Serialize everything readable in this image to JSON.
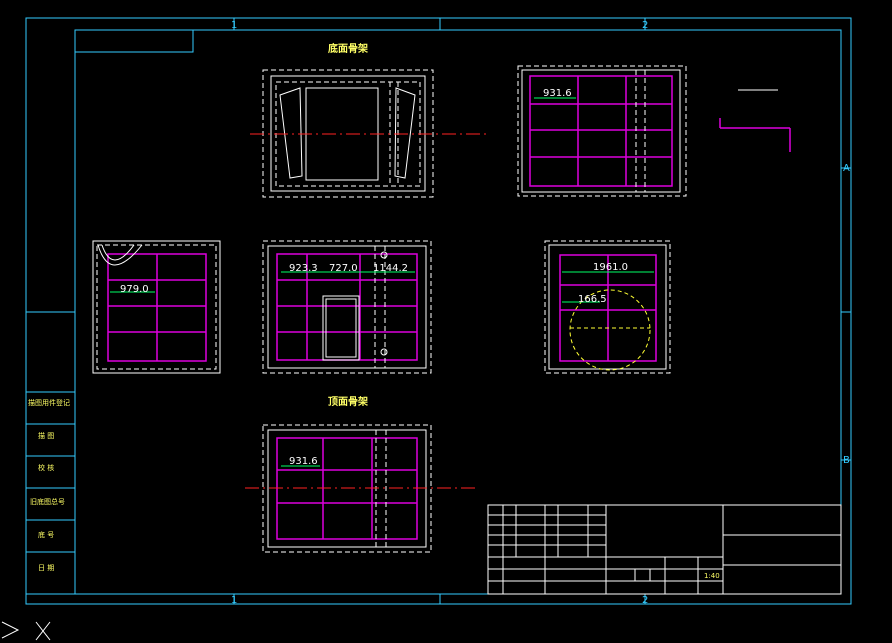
{
  "drawing": {
    "view_titles": {
      "bottom_frame": "底面骨架",
      "top_frame": "顶面骨架"
    },
    "dimensions": {
      "top_right_view": "931.6",
      "left_view": "979.0",
      "front_view_a": "923.3",
      "front_view_b": "727.0",
      "front_view_c": "1144.2",
      "right_view_width": "1961.0",
      "right_view_small": "166.5",
      "top_frame_view": "931.6"
    },
    "border_grid": {
      "col1": "1",
      "col2": "2",
      "row_a": "A",
      "row_b": "B"
    },
    "side_block_labels": [
      "描图用件登记",
      "描 图",
      "校 核",
      "旧底图总号",
      "底 号",
      "日 期"
    ],
    "title_block": {
      "scale": "1:40"
    },
    "colors": {
      "background": "#000000",
      "border": "#33ccff",
      "geometry": "#ffffff",
      "shelves": "#dd00dd",
      "dimensions": "#00ff66",
      "centerline": "#ff2222",
      "hidden": "#ffff33"
    },
    "icons": [
      "ucs-icon"
    ]
  }
}
